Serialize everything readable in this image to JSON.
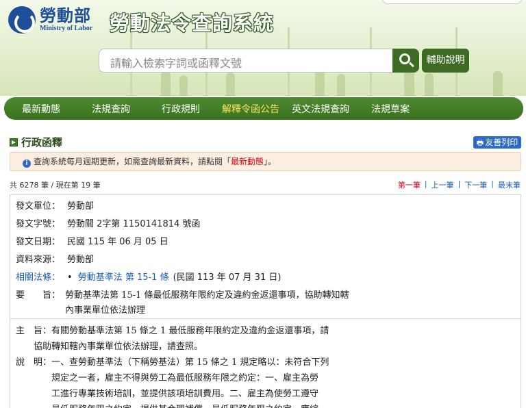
{
  "header": {
    "logo_cn": "勞動部",
    "logo_en": "Ministry of Labor",
    "system_title": "勞動法令查詢系統",
    "search_placeholder": "請輸入檢索字詞或函釋文號",
    "help_label": "輔助說明"
  },
  "nav": {
    "items": [
      {
        "label": "最新動態"
      },
      {
        "label": "法規查詢"
      },
      {
        "label": "行政規則"
      },
      {
        "label": "解釋令函公告"
      },
      {
        "label": "英文法規查詢"
      },
      {
        "label": "法規草案"
      }
    ],
    "active_index": 3
  },
  "section": {
    "title": "行政函釋",
    "print_label": "友善列印"
  },
  "notice": {
    "text_before": "查詢系統每月週期更新，如需查詢最新資料，請點閱「",
    "link_text": "最新動態",
    "text_after": "」。"
  },
  "counter": {
    "text": "共 6278 筆 / 現在第 19 筆"
  },
  "pager": {
    "first": "第一筆",
    "prev": "上一筆",
    "next": "下一筆",
    "last": "最末筆",
    "sep": "|"
  },
  "record": {
    "issuer_label": "發文單位：",
    "issuer": "勞動部",
    "doc_no_label": "發文字號：",
    "doc_no": "勞動關 2字第 1150141814 號函",
    "date_label": "發文日期：",
    "date": "民國 115 年 06 月 05 日",
    "source_label": "資料來源：",
    "source": "勞動部",
    "related_label": "相關法條：",
    "related_link": "勞動基準法 第 15-1 條",
    "related_date": "(民國 113 年 07 月 31 日)",
    "summary_label": "要　　旨：",
    "summary_line1": "勞動基準法第 15-1 條最低服務年限約定及違約金返還事項，協助轉知轄",
    "summary_line2": "內事業單位依法辦理",
    "body_lines": [
      "主　旨：有關勞動基準法第 15 條之 1  最低服務年限約定及違約金返還事項，請",
      "　　協助轉知轄內事業單位依法辦理，請查照。",
      "說　明：一、查勞動基準法（下稱勞基法）第 15 條之 1  規定略以：未符合下列",
      "　　　　規定之一者，雇主不得與勞工為最低服務年限之約定：一、雇主為勞",
      "　　　　工進行專業技術培訓，並提供該項培訓費用。二、雇主為使勞工遵守",
      "　　　　最低服務年限之約定，提供其合理補償。最低服務年限之約定，應綜"
    ]
  }
}
